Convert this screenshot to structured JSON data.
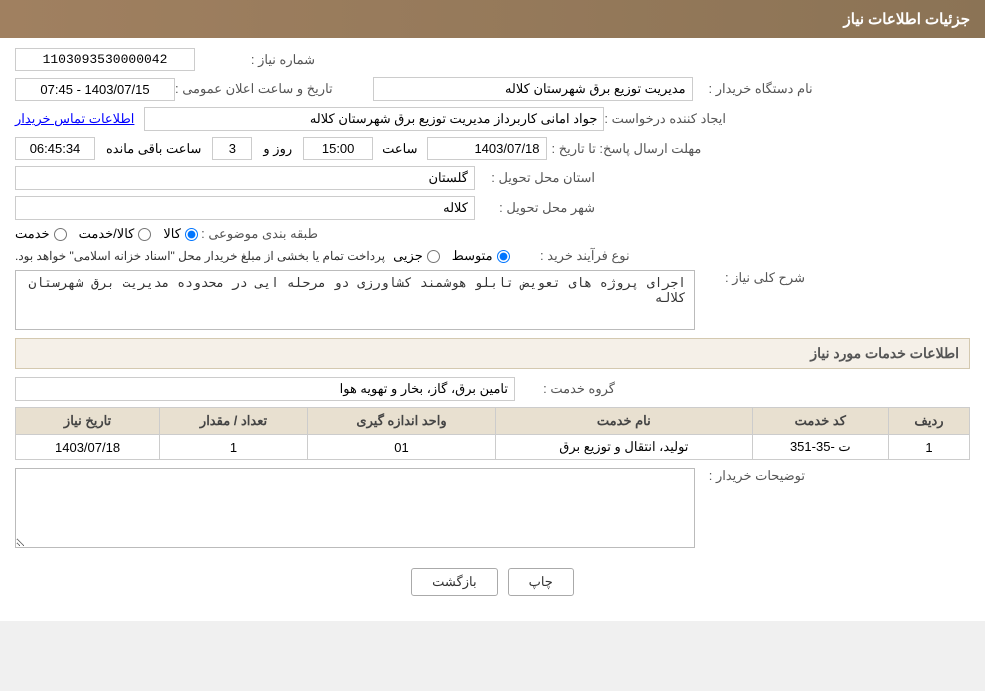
{
  "header": {
    "title": "جزئیات اطلاعات نیاز"
  },
  "fields": {
    "request_number_label": "شماره نیاز :",
    "request_number_value": "1103093530000042",
    "buyer_org_label": "نام دستگاه خریدار :",
    "buyer_org_value": "مدیریت توزیع برق شهرستان کلاله",
    "requester_label": "ایجاد کننده درخواست :",
    "requester_value": "جواد امانی کاربرداز مدیریت توزیع برق شهرستان کلاله",
    "contact_info_label": "اطلاعات تماس خریدار",
    "announce_datetime_label": "تاریخ و ساعت اعلان عمومی :",
    "announce_datetime_value": "1403/07/15 - 07:45",
    "response_deadline_label": "مهلت ارسال پاسخ: تا تاریخ :",
    "deadline_date_value": "1403/07/18",
    "deadline_time_label": "ساعت",
    "deadline_time_value": "15:00",
    "days_label": "روز و",
    "days_value": "3",
    "remaining_label": "ساعت باقی مانده",
    "remaining_value": "06:45:34",
    "province_label": "استان محل تحویل :",
    "province_value": "گلستان",
    "city_label": "شهر محل تحویل :",
    "city_value": "کلاله",
    "category_label": "طبقه بندی موضوعی :",
    "category_options": [
      "خدمت",
      "کالا/خدمت",
      "کالا"
    ],
    "category_selected": "کالا",
    "purchase_type_label": "نوع فرآیند خرید :",
    "purchase_type_options": [
      "جزیی",
      "متوسط"
    ],
    "purchase_type_selected": "متوسط",
    "payment_note": "پرداخت تمام یا بخشی از مبلغ خریدار محل \"اسناد خزانه اسلامی\" خواهد بود.",
    "description_label": "شرح کلی نیاز :",
    "description_value": "اجرای پروژه های تعویض تابلو هوشمند کشاورزی دو مرحله ایی در محدوده مدیریت برق شهرستان کلاله",
    "services_heading": "اطلاعات خدمات مورد نیاز",
    "service_group_label": "گروه خدمت :",
    "service_group_value": "تامین برق، گاز، بخار و تهویه هوا",
    "table_columns": [
      "ردیف",
      "کد خدمت",
      "نام خدمت",
      "واحد اندازه گیری",
      "تعداد / مقدار",
      "تاریخ نیاز"
    ],
    "table_rows": [
      {
        "row": "1",
        "code": "ت -35-351",
        "name": "تولید، انتقال و توزیع برق",
        "unit": "01",
        "quantity": "1",
        "date": "1403/07/18"
      }
    ],
    "buyer_notes_label": "توضیحات خریدار :",
    "buyer_notes_value": ""
  },
  "buttons": {
    "print_label": "چاپ",
    "back_label": "بازگشت"
  }
}
